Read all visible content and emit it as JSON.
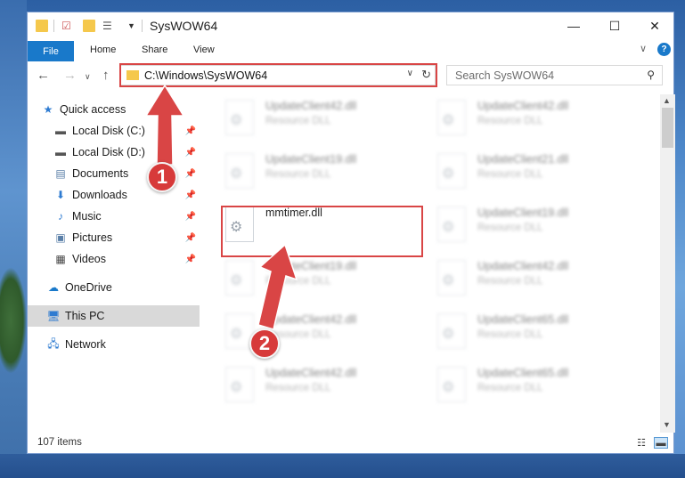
{
  "window": {
    "title": "SysWOW64",
    "controls": {
      "minimize": "—",
      "maximize": "☐",
      "close": "✕"
    }
  },
  "ribbon": {
    "tabs": [
      "File",
      "Home",
      "Share",
      "View"
    ],
    "help": "?"
  },
  "address": {
    "path": "C:\\Windows\\SysWOW64",
    "search_placeholder": "Search SysWOW64"
  },
  "sidebar": {
    "items": [
      {
        "label": "Quick access",
        "icon": "star-icon"
      },
      {
        "label": "Local Disk (C:)",
        "icon": "drive-icon",
        "pinned": true
      },
      {
        "label": "Local Disk (D:)",
        "icon": "drive-icon",
        "pinned": true
      },
      {
        "label": "Documents",
        "icon": "document-icon",
        "pinned": true
      },
      {
        "label": "Downloads",
        "icon": "download-icon",
        "pinned": true
      },
      {
        "label": "Music",
        "icon": "music-icon",
        "pinned": true
      },
      {
        "label": "Pictures",
        "icon": "pictures-icon",
        "pinned": true
      },
      {
        "label": "Videos",
        "icon": "video-icon",
        "pinned": true
      },
      {
        "label": "OneDrive",
        "icon": "cloud-icon"
      },
      {
        "label": "This PC",
        "icon": "computer-icon",
        "selected": true
      },
      {
        "label": "Network",
        "icon": "network-icon"
      }
    ]
  },
  "files": [
    {
      "name": "UpdateClient42.dll",
      "desc": "Resource DLL"
    },
    {
      "name": "UpdateClient42.dll",
      "desc": "Resource DLL"
    },
    {
      "name": "UpdateClient19.dll",
      "desc": "Resource DLL"
    },
    {
      "name": "UpdateClient21.dll",
      "desc": "Resource DLL"
    },
    {
      "name": "mmtimer.dll",
      "desc": ""
    },
    {
      "name": "UpdateClient19.dll",
      "desc": "Resource DLL"
    },
    {
      "name": "UpdateClient19.dll",
      "desc": "Resource DLL"
    },
    {
      "name": "UpdateClient42.dll",
      "desc": "Resource DLL"
    },
    {
      "name": "UpdateClient42.dll",
      "desc": "Resource DLL"
    },
    {
      "name": "UpdateClient65.dll",
      "desc": "Resource DLL"
    },
    {
      "name": "UpdateClient42.dll",
      "desc": "Resource DLL"
    },
    {
      "name": "UpdateClient65.dll",
      "desc": "Resource DLL"
    }
  ],
  "status": {
    "item_count": "107 items"
  },
  "annotations": {
    "step1": "1",
    "step2": "2",
    "color": "#d94545"
  }
}
